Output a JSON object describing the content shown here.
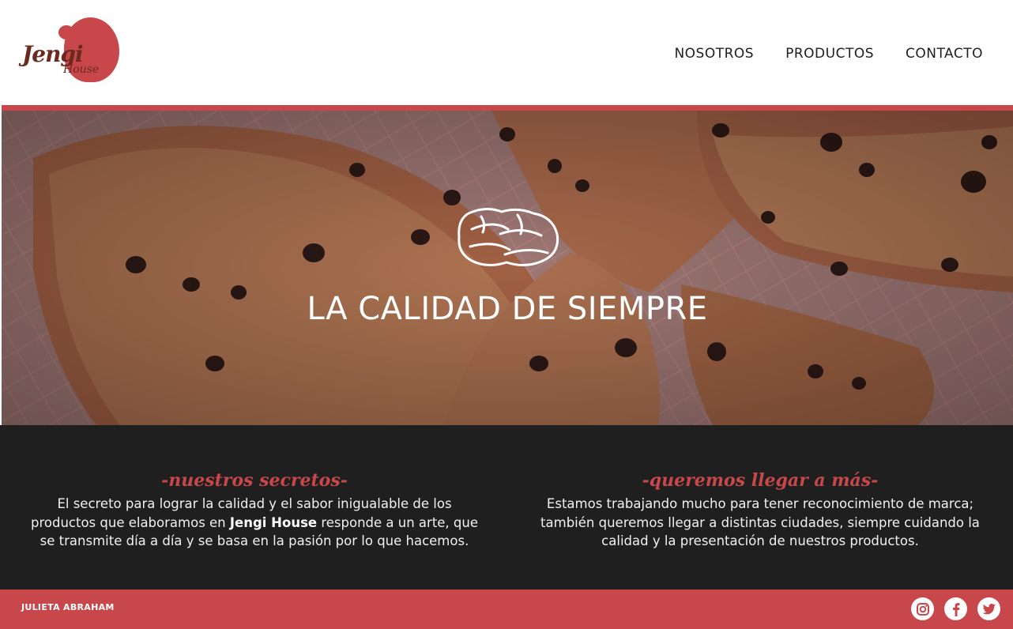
{
  "brand": {
    "logo_word": "Jengi",
    "logo_sub": "House",
    "logo_color": "#c8474a"
  },
  "nav": {
    "items": [
      {
        "label": "NOSOTROS"
      },
      {
        "label": "PRODUCTOS"
      },
      {
        "label": "CONTACTO"
      }
    ]
  },
  "hero": {
    "title": "LA CALIDAD DE SIEMPRE",
    "icon": "bread-icon"
  },
  "sections": {
    "left": {
      "heading": "-nuestros secretos-",
      "text_before": "El secreto para lograr la calidad y el sabor inigualable de los productos que elaboramos en ",
      "text_bold": "Jengi House",
      "text_after": " responde a un arte, que se transmite día a día y se basa en la pasión por lo que hacemos."
    },
    "right": {
      "heading": "-queremos llegar a más-",
      "text": "Estamos trabajando mucho para tener reconocimiento de marca; también queremos llegar a distintas ciudades, siempre cuidando la calidad y la presentación de nuestros productos."
    }
  },
  "footer": {
    "author": "JULIETA ABRAHAM",
    "social": [
      {
        "icon": "instagram-icon"
      },
      {
        "icon": "facebook-icon"
      },
      {
        "icon": "twitter-icon"
      }
    ]
  },
  "colors": {
    "accent": "#c8474a",
    "dark": "#1f1f1f",
    "text_dark": "#1e1e1e"
  }
}
